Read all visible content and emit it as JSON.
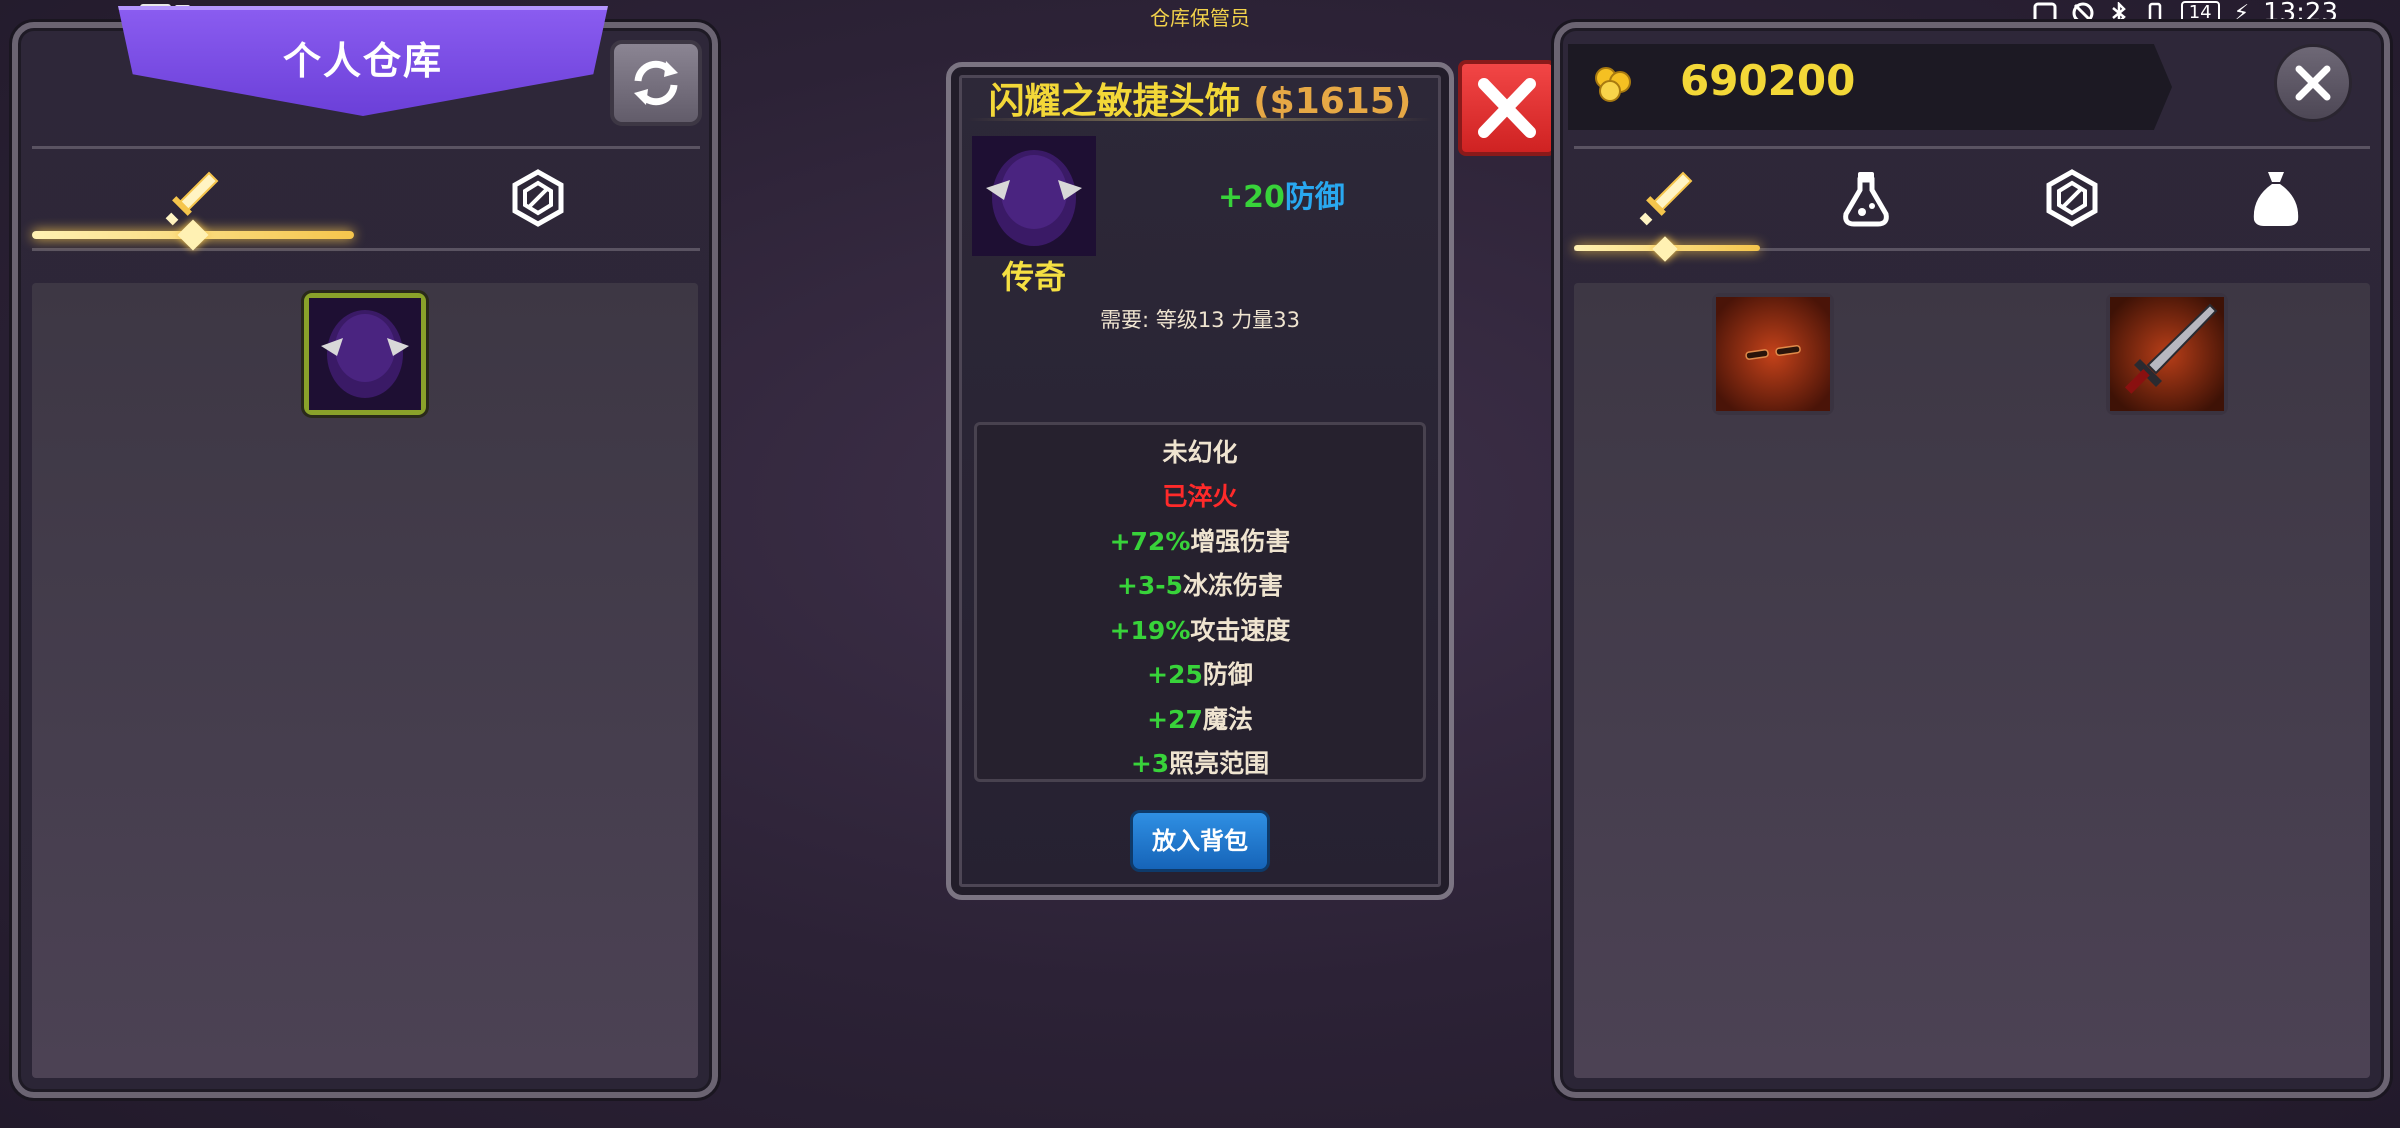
{
  "status_bar": {
    "hd_label": "HD",
    "sim_slot": "2",
    "battery": "14",
    "time": "13:23"
  },
  "npc_title": "仓库保管员",
  "left_panel": {
    "title": "个人仓库",
    "tabs": [
      {
        "icon": "sword-icon",
        "active": true
      },
      {
        "icon": "gem-icon",
        "active": false
      }
    ]
  },
  "tooltip": {
    "item_name": "闪耀之敏捷头饰",
    "price": "($1615)",
    "base_stat_value": "+20",
    "base_stat_name": "防御",
    "rarity": "传奇",
    "requirement": "需要: 等级13 力量33",
    "illusion_status": "未幻化",
    "temper_status": "已淬火",
    "stats": [
      {
        "value": "+72%",
        "name": "增强伤害"
      },
      {
        "value": "+3-5",
        "name": "冰冻伤害"
      },
      {
        "value": "+19%",
        "name": "攻击速度"
      },
      {
        "value": "+25",
        "name": "防御"
      },
      {
        "value": "+27",
        "name": "魔法"
      },
      {
        "value": "+3",
        "name": "照亮范围"
      }
    ],
    "action_label": "放入背包"
  },
  "right_panel": {
    "gold": "690200",
    "tabs": [
      {
        "icon": "sword-icon",
        "active": true
      },
      {
        "icon": "potion-icon",
        "active": false
      },
      {
        "icon": "gem-icon",
        "active": false
      },
      {
        "icon": "bag-icon",
        "active": false
      }
    ]
  },
  "colors": {
    "accent_purple": "#7a4ee6",
    "gold_text": "#f3d838",
    "stat_green": "#38d33a",
    "defense_blue": "#29a8f0",
    "temper_red": "#ff2a2a",
    "legend_yellow": "#f5e042"
  }
}
